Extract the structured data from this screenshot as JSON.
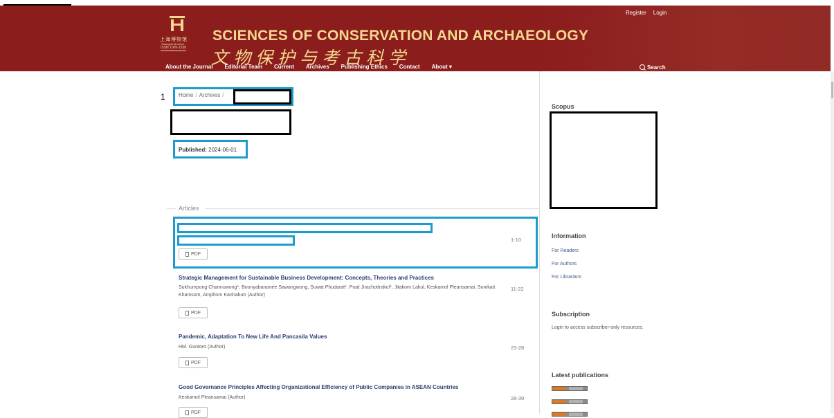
{
  "header": {
    "title": "SCIENCES OF CONSERVATION AND ARCHAEOLOGY",
    "title_cn": "文物保护与考古科学",
    "museum_cn": "上海博物馆",
    "museum_en": "Shanghai Museum",
    "issn": "ISSN 1005-1538",
    "user_links": [
      "Register",
      "Login"
    ],
    "nav": [
      "About the Journal",
      "Editorial Team",
      "Current",
      "Archives",
      "Publishing Ethics",
      "Contact",
      "About ▾"
    ],
    "search_label": "Search"
  },
  "annotation_marker": "1",
  "breadcrumb": {
    "home": "Home",
    "archives": "Archives"
  },
  "published": {
    "label": "Published:",
    "date": "2024-06-01"
  },
  "section_heading": "Articles",
  "articles": [
    {
      "title": "",
      "authors": "",
      "pages": "1-10",
      "pdf": "PDF"
    },
    {
      "title": "Strategic Management for Sustainable Business Development: Concepts, Theories and Practices",
      "authors": "Sukhumpong Channuwong*, Boonyabaramee Sawangwong, Suwat Phudarat*, Prad Jirachottrakul*, Jitakorn Lakul, Keskamol Pleansamai, Somkait Khamsom, Amphorn Kanhabutr (Author)",
      "pages": "11-22",
      "pdf": "PDF"
    },
    {
      "title": "Pandemic, Adaptation To New Life And Pancasila Values",
      "authors": "HM. Guntoro (Author)",
      "pages": "23-28",
      "pdf": "PDF"
    },
    {
      "title": "Good Governance Principles Affecting Organizational Efficiency of Public Companies in ASEAN Countries",
      "authors": "Keskamol Pleansamai (Author)",
      "pages": "28-39",
      "pdf": "PDF"
    }
  ],
  "sidebar": {
    "scopus_heading": "Scopus",
    "information_heading": "Information",
    "information_links": [
      "For Readers",
      "For Authors",
      "For Librarians"
    ],
    "subscription_heading": "Subscription",
    "subscription_text": "Login to access subscriber-only resources.",
    "latest_heading": "Latest publications",
    "feed_badges": [
      "ATOM 1.0",
      "RSS 2.0",
      "RSS 1.0"
    ]
  },
  "colors": {
    "header_bg": "#8b1d1d",
    "title_gold": "#f3d78f",
    "annotation_blue": "#1b9ccc",
    "link_blue": "#3d5a8c"
  }
}
